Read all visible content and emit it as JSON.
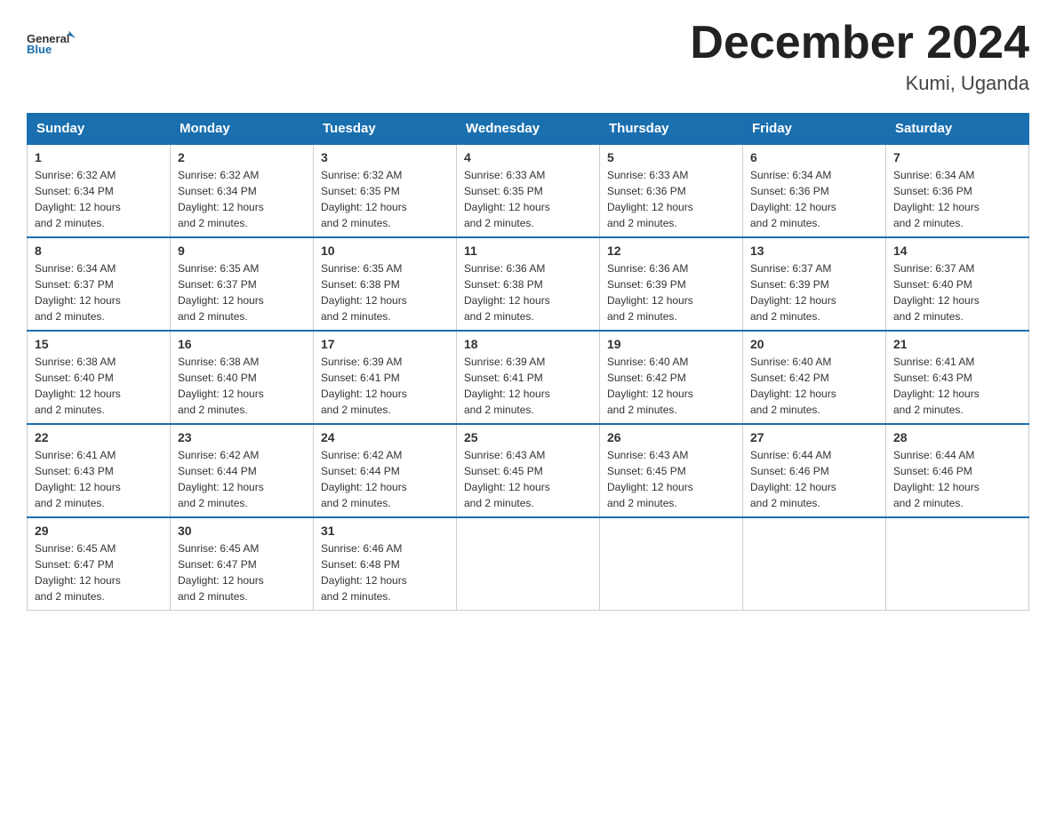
{
  "header": {
    "logo_text_general": "General",
    "logo_text_blue": "Blue",
    "month_title": "December 2024",
    "location": "Kumi, Uganda"
  },
  "calendar": {
    "days_of_week": [
      "Sunday",
      "Monday",
      "Tuesday",
      "Wednesday",
      "Thursday",
      "Friday",
      "Saturday"
    ],
    "weeks": [
      [
        {
          "day": "1",
          "sunrise": "6:32 AM",
          "sunset": "6:34 PM",
          "daylight": "12 hours and 2 minutes."
        },
        {
          "day": "2",
          "sunrise": "6:32 AM",
          "sunset": "6:34 PM",
          "daylight": "12 hours and 2 minutes."
        },
        {
          "day": "3",
          "sunrise": "6:32 AM",
          "sunset": "6:35 PM",
          "daylight": "12 hours and 2 minutes."
        },
        {
          "day": "4",
          "sunrise": "6:33 AM",
          "sunset": "6:35 PM",
          "daylight": "12 hours and 2 minutes."
        },
        {
          "day": "5",
          "sunrise": "6:33 AM",
          "sunset": "6:36 PM",
          "daylight": "12 hours and 2 minutes."
        },
        {
          "day": "6",
          "sunrise": "6:34 AM",
          "sunset": "6:36 PM",
          "daylight": "12 hours and 2 minutes."
        },
        {
          "day": "7",
          "sunrise": "6:34 AM",
          "sunset": "6:36 PM",
          "daylight": "12 hours and 2 minutes."
        }
      ],
      [
        {
          "day": "8",
          "sunrise": "6:34 AM",
          "sunset": "6:37 PM",
          "daylight": "12 hours and 2 minutes."
        },
        {
          "day": "9",
          "sunrise": "6:35 AM",
          "sunset": "6:37 PM",
          "daylight": "12 hours and 2 minutes."
        },
        {
          "day": "10",
          "sunrise": "6:35 AM",
          "sunset": "6:38 PM",
          "daylight": "12 hours and 2 minutes."
        },
        {
          "day": "11",
          "sunrise": "6:36 AM",
          "sunset": "6:38 PM",
          "daylight": "12 hours and 2 minutes."
        },
        {
          "day": "12",
          "sunrise": "6:36 AM",
          "sunset": "6:39 PM",
          "daylight": "12 hours and 2 minutes."
        },
        {
          "day": "13",
          "sunrise": "6:37 AM",
          "sunset": "6:39 PM",
          "daylight": "12 hours and 2 minutes."
        },
        {
          "day": "14",
          "sunrise": "6:37 AM",
          "sunset": "6:40 PM",
          "daylight": "12 hours and 2 minutes."
        }
      ],
      [
        {
          "day": "15",
          "sunrise": "6:38 AM",
          "sunset": "6:40 PM",
          "daylight": "12 hours and 2 minutes."
        },
        {
          "day": "16",
          "sunrise": "6:38 AM",
          "sunset": "6:40 PM",
          "daylight": "12 hours and 2 minutes."
        },
        {
          "day": "17",
          "sunrise": "6:39 AM",
          "sunset": "6:41 PM",
          "daylight": "12 hours and 2 minutes."
        },
        {
          "day": "18",
          "sunrise": "6:39 AM",
          "sunset": "6:41 PM",
          "daylight": "12 hours and 2 minutes."
        },
        {
          "day": "19",
          "sunrise": "6:40 AM",
          "sunset": "6:42 PM",
          "daylight": "12 hours and 2 minutes."
        },
        {
          "day": "20",
          "sunrise": "6:40 AM",
          "sunset": "6:42 PM",
          "daylight": "12 hours and 2 minutes."
        },
        {
          "day": "21",
          "sunrise": "6:41 AM",
          "sunset": "6:43 PM",
          "daylight": "12 hours and 2 minutes."
        }
      ],
      [
        {
          "day": "22",
          "sunrise": "6:41 AM",
          "sunset": "6:43 PM",
          "daylight": "12 hours and 2 minutes."
        },
        {
          "day": "23",
          "sunrise": "6:42 AM",
          "sunset": "6:44 PM",
          "daylight": "12 hours and 2 minutes."
        },
        {
          "day": "24",
          "sunrise": "6:42 AM",
          "sunset": "6:44 PM",
          "daylight": "12 hours and 2 minutes."
        },
        {
          "day": "25",
          "sunrise": "6:43 AM",
          "sunset": "6:45 PM",
          "daylight": "12 hours and 2 minutes."
        },
        {
          "day": "26",
          "sunrise": "6:43 AM",
          "sunset": "6:45 PM",
          "daylight": "12 hours and 2 minutes."
        },
        {
          "day": "27",
          "sunrise": "6:44 AM",
          "sunset": "6:46 PM",
          "daylight": "12 hours and 2 minutes."
        },
        {
          "day": "28",
          "sunrise": "6:44 AM",
          "sunset": "6:46 PM",
          "daylight": "12 hours and 2 minutes."
        }
      ],
      [
        {
          "day": "29",
          "sunrise": "6:45 AM",
          "sunset": "6:47 PM",
          "daylight": "12 hours and 2 minutes."
        },
        {
          "day": "30",
          "sunrise": "6:45 AM",
          "sunset": "6:47 PM",
          "daylight": "12 hours and 2 minutes."
        },
        {
          "day": "31",
          "sunrise": "6:46 AM",
          "sunset": "6:48 PM",
          "daylight": "12 hours and 2 minutes."
        },
        null,
        null,
        null,
        null
      ]
    ]
  }
}
